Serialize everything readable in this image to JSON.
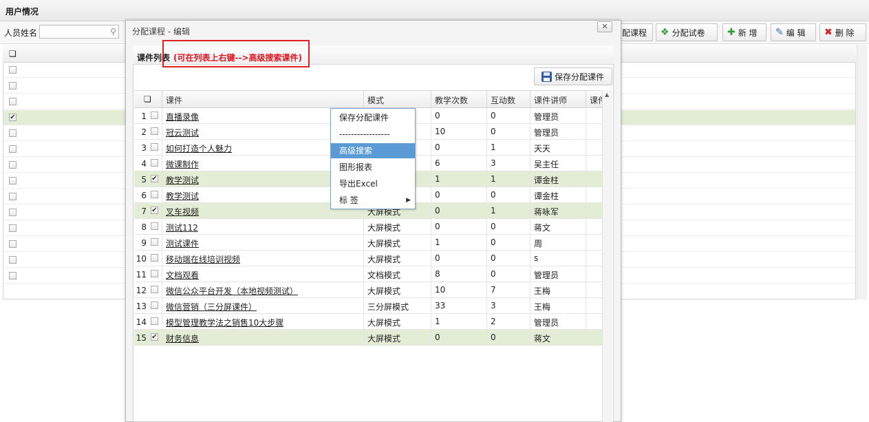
{
  "page": {
    "title": "用户情况"
  },
  "search": {
    "label": "人员姓名",
    "value": ""
  },
  "toolbar": {
    "assign_course": "配课程",
    "assign_exam": "分配试卷",
    "add": "新 增",
    "edit": "编 辑",
    "delete": "删 除"
  },
  "dialog": {
    "title": "分配课程 - 编辑",
    "close": "✕",
    "panel_title": "课件列表",
    "hint": "(可在列表上右键-->高级搜索课件)",
    "save_button": "保存分配课件"
  },
  "grid": {
    "headers": [
      "课件",
      "模式",
      "教学次数",
      "互动数",
      "课件讲师",
      "课件"
    ],
    "rows": [
      {
        "n": "1",
        "name": "直播录像",
        "mode": "",
        "teach": "0",
        "inter": "0",
        "lect": "管理员",
        "checked": false
      },
      {
        "n": "2",
        "name": "冠云测试",
        "mode": "",
        "teach": "10",
        "inter": "0",
        "lect": "管理员",
        "checked": false
      },
      {
        "n": "3",
        "name": "如何打造个人魅力",
        "mode": "",
        "teach": "0",
        "inter": "1",
        "lect": "天天",
        "checked": false
      },
      {
        "n": "4",
        "name": "微课制作",
        "mode": "",
        "teach": "6",
        "inter": "3",
        "lect": "吴主任",
        "checked": false
      },
      {
        "n": "5",
        "name": "教学测试",
        "mode": "",
        "teach": "1",
        "inter": "1",
        "lect": "谭金柱",
        "checked": true
      },
      {
        "n": "6",
        "name": "教学测试",
        "mode": "",
        "teach": "0",
        "inter": "0",
        "lect": "谭金柱",
        "checked": false
      },
      {
        "n": "7",
        "name": "叉车视频",
        "mode": "大屏模式",
        "teach": "0",
        "inter": "1",
        "lect": "蒋咏军",
        "checked": true
      },
      {
        "n": "8",
        "name": "测试112",
        "mode": "大屏模式",
        "teach": "0",
        "inter": "0",
        "lect": "蒋文",
        "checked": false
      },
      {
        "n": "9",
        "name": "测试课件",
        "mode": "大屏模式",
        "teach": "1",
        "inter": "0",
        "lect": "周",
        "checked": false
      },
      {
        "n": "10",
        "name": "移动端在线培训视频",
        "mode": "大屏模式",
        "teach": "0",
        "inter": "0",
        "lect": "s",
        "checked": false
      },
      {
        "n": "11",
        "name": "文档观看",
        "mode": "文档模式",
        "teach": "8",
        "inter": "0",
        "lect": "管理员",
        "checked": false
      },
      {
        "n": "12",
        "name": "微信公众平台开发（本地视频测试）",
        "mode": "大屏模式",
        "teach": "10",
        "inter": "7",
        "lect": "王梅",
        "checked": false
      },
      {
        "n": "13",
        "name": "微信营销（三分屏课件）",
        "mode": "三分屏模式",
        "teach": "33",
        "inter": "3",
        "lect": "王梅",
        "checked": false
      },
      {
        "n": "14",
        "name": "模型管理教学法之销售10大步骤",
        "mode": "大屏模式",
        "teach": "1",
        "inter": "2",
        "lect": "管理员",
        "checked": false
      },
      {
        "n": "15",
        "name": "财务信息",
        "mode": "大屏模式",
        "teach": "0",
        "inter": "0",
        "lect": "蒋文",
        "checked": true
      }
    ]
  },
  "context_menu": {
    "items": [
      "保存分配课件",
      "-----------------",
      "高级搜索",
      "图形报表",
      "导出Excel",
      "标 签"
    ]
  },
  "colors": {
    "selected_row": "#e3edd5",
    "menu_highlight": "#5b9bd5",
    "hint_red": "#e0141e"
  },
  "icons": {
    "search": "search-icon",
    "assign_exam": "arrows-icon",
    "add": "plus-icon",
    "edit": "pencil-icon",
    "delete": "x-icon",
    "save": "floppy-icon",
    "grid_header": "columns-icon"
  }
}
